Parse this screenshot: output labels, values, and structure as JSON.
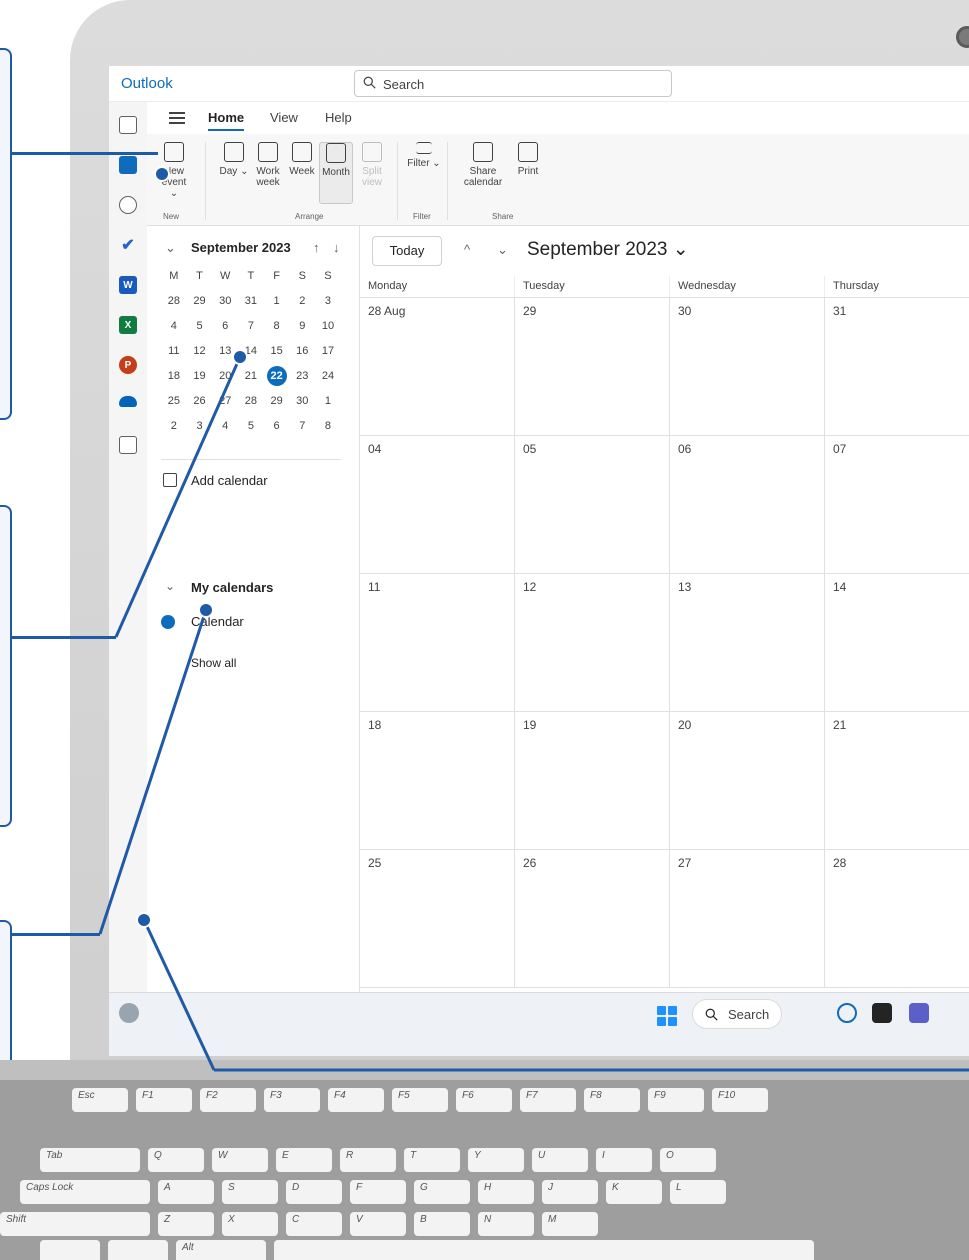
{
  "app": {
    "title": "Outlook"
  },
  "search": {
    "placeholder": "Search"
  },
  "menu": {
    "tabs": [
      "Home",
      "View",
      "Help"
    ]
  },
  "ribbon": {
    "buttons": {
      "new_event": "New event ⌄",
      "day": "Day ⌄",
      "work_week": "Work week",
      "week": "Week",
      "month": "Month",
      "split_view": "Split view",
      "filter": "Filter ⌄",
      "share_calendar": "Share calendar",
      "print": "Print"
    },
    "groups": {
      "new": "New",
      "arrange": "Arrange",
      "filter": "Filter",
      "share": "Share"
    }
  },
  "mini_calendar": {
    "title": "September 2023",
    "weekdays": [
      "M",
      "T",
      "W",
      "T",
      "F",
      "S",
      "S"
    ],
    "weeks": [
      [
        "28",
        "29",
        "30",
        "31",
        "1",
        "2",
        "3"
      ],
      [
        "4",
        "5",
        "6",
        "7",
        "8",
        "9",
        "10"
      ],
      [
        "11",
        "12",
        "13",
        "14",
        "15",
        "16",
        "17"
      ],
      [
        "18",
        "19",
        "20",
        "21",
        "22",
        "23",
        "24"
      ],
      [
        "25",
        "26",
        "27",
        "28",
        "29",
        "30",
        "1"
      ],
      [
        "2",
        "3",
        "4",
        "5",
        "6",
        "7",
        "8"
      ]
    ],
    "today": "22"
  },
  "sidebar": {
    "add_calendar": "Add calendar",
    "my_calendars": "My calendars",
    "calendar": "Calendar",
    "show_all": "Show all"
  },
  "calendar": {
    "today_btn": "Today",
    "month_title": "September 2023 ⌄",
    "headers": [
      "Monday",
      "Tuesday",
      "Wednesday",
      "Thursday"
    ],
    "weeks": [
      [
        "28 Aug",
        "29",
        "30",
        "31"
      ],
      [
        "04",
        "05",
        "06",
        "07"
      ],
      [
        "11",
        "12",
        "13",
        "14"
      ],
      [
        "18",
        "19",
        "20",
        "21"
      ],
      [
        "25",
        "26",
        "27",
        "28"
      ]
    ]
  },
  "taskbar": {
    "search": "Search"
  },
  "keyboard": {
    "row1": [
      "Esc",
      "F1",
      "F2",
      "F3",
      "F4",
      "F5",
      "F6",
      "F7",
      "F8",
      "F9",
      "F10"
    ],
    "row2": [
      "Tab",
      "Q",
      "W",
      "E",
      "R",
      "T",
      "Y",
      "U",
      "I",
      "O"
    ],
    "row3": [
      "Caps Lock",
      "A",
      "S",
      "D",
      "F",
      "G",
      "H",
      "J",
      "K",
      "L"
    ],
    "row4": [
      "Shift",
      "Z",
      "X",
      "C",
      "V",
      "B",
      "N",
      "M"
    ],
    "row5": [
      "Alt"
    ]
  },
  "colors": {
    "accent": "#0f6cbd",
    "callout": "#1f5aa6"
  }
}
